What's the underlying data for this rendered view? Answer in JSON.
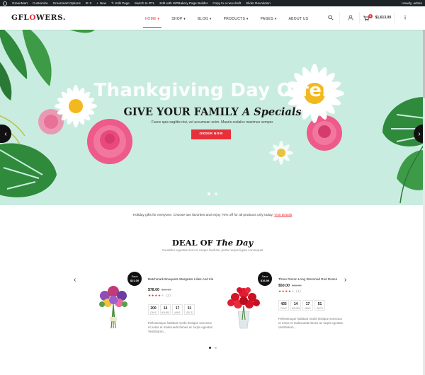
{
  "admin_bar": {
    "items": [
      "GreenMart",
      "Customize",
      "Greenmart Options",
      "0",
      "New",
      "Edit Page",
      "Switch to RTL",
      "Edit with WPBakery Page Builder",
      "Copy to a new draft",
      "Slider Revolution"
    ],
    "account": "Howdy, admin"
  },
  "header": {
    "logo_pre": "GFL",
    "logo_o": "O",
    "logo_post": "WERS.",
    "nav": [
      {
        "label": "HOME",
        "caret": "▾",
        "active": true
      },
      {
        "label": "SHOP",
        "caret": "▾"
      },
      {
        "label": "BLOG",
        "caret": "▾"
      },
      {
        "label": "PRODUCTS",
        "caret": "▾"
      },
      {
        "label": "PAGES",
        "caret": "▾"
      },
      {
        "label": "ABOUT US",
        "caret": ""
      }
    ],
    "cart_count": "0",
    "cart_total": "$1,613.00"
  },
  "hero": {
    "title": "Thankgiving Day Offer",
    "subtitle_plain": "GIVE YOUR FAMILY",
    "subtitle_italic": "A Specials",
    "description": "Fusce quis sagittis nisi, vel accumsan enim. Mauris sodales maximus semper.",
    "button": "ORDER NOW"
  },
  "promo": {
    "text": "Holiday gifts for everyone. Choose two favorites and enjoy 70% off for all products only today.",
    "link": "Visit Details"
  },
  "deal": {
    "title_plain": "DEAL OF",
    "title_italic": "The Day",
    "description": "Curabitur egestas sem et neque facilisis, porta neque ligula consequat"
  },
  "products": [
    {
      "save_label": "Save",
      "save_amount": "$21.00",
      "name": "Batchmark Bouquets Stargazer Lilies And Iris",
      "price": "$78.00",
      "old_price": "$99.00",
      "rating_count": "(2)",
      "timer": [
        {
          "v": "200",
          "l": "DAYS"
        },
        {
          "v": "14",
          "l": "HOURS"
        },
        {
          "v": "17",
          "l": "MINS"
        },
        {
          "v": "51",
          "l": "SECS"
        }
      ],
      "description": "Pellentesque habitant morbi tristique senectus et netus et malesuada fames ac turpis egestas. Vestibulum..."
    },
    {
      "save_label": "Save",
      "save_amount": "$16.99",
      "name": "Three Dozen Long Stemmed Red Roses",
      "price": "$50.00",
      "old_price": "$66.99",
      "rating_count": "(1)",
      "timer": [
        {
          "v": "435",
          "l": "DAYS"
        },
        {
          "v": "14",
          "l": "HOURS"
        },
        {
          "v": "17",
          "l": "MINS"
        },
        {
          "v": "51",
          "l": "SECS"
        }
      ],
      "description": "Pellentesque habitant morbi tristique senectus et netus et malesuada fames ac turpis egestas. Vestibulum..."
    }
  ],
  "colors": {
    "accent": "#e9303a",
    "hero_bg": "#c9ece0",
    "admin_bar": "#1d2327"
  }
}
